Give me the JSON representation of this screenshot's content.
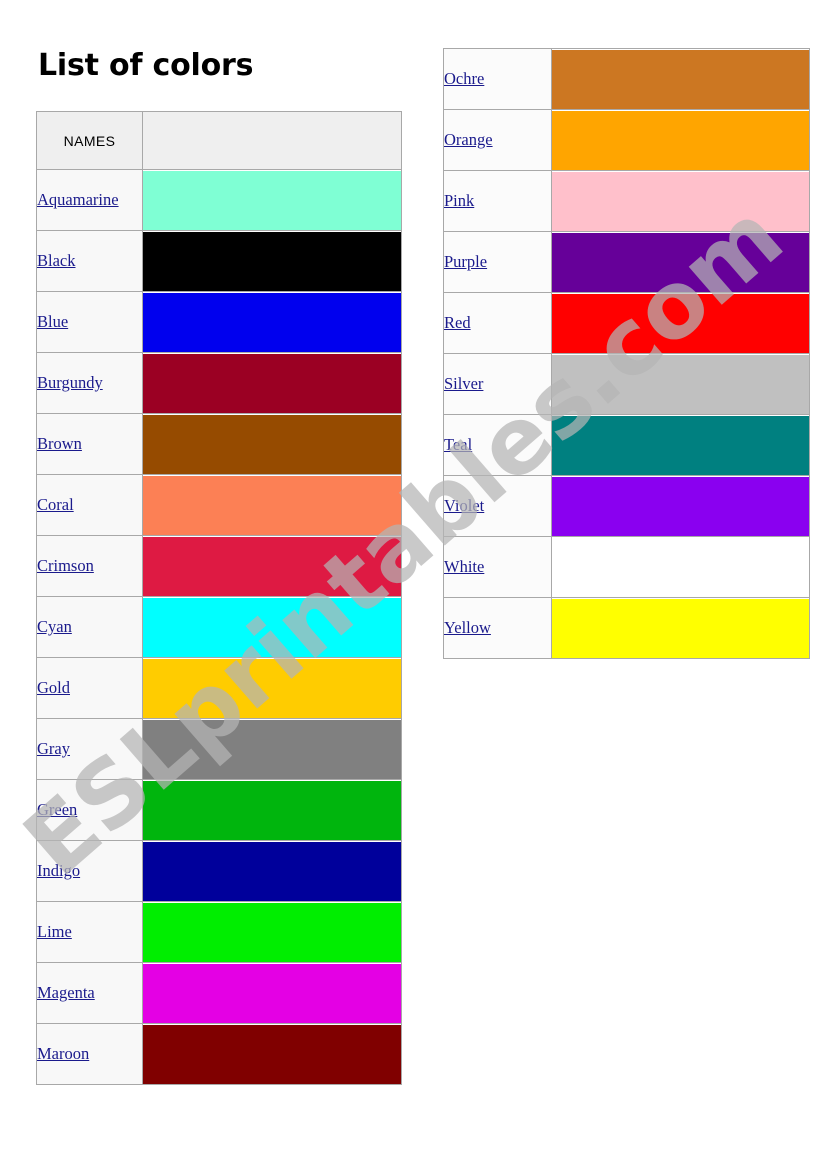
{
  "page": {
    "title": "List of colors",
    "watermark": "ESLprintables.com",
    "watermark_color": "#b4b4b4"
  },
  "left_table": {
    "header": {
      "names_label": "NAMES",
      "swatch_label": "",
      "background": "#efefef"
    },
    "rows": [
      {
        "name": "Aquamarine",
        "color": "#7FFFD4"
      },
      {
        "name": "Black",
        "color": "#000000"
      },
      {
        "name": "Blue",
        "color": "#0000EE"
      },
      {
        "name": "Burgundy",
        "color": "#9B0023"
      },
      {
        "name": "Brown",
        "color": "#964B00"
      },
      {
        "name": "Coral",
        "color": "#FC8055"
      },
      {
        "name": "Crimson",
        "color": "#DE1A43"
      },
      {
        "name": "Cyan",
        "color": "#00FFFF"
      },
      {
        "name": "Gold",
        "color": "#FFCC00"
      },
      {
        "name": "Gray",
        "color": "#808080"
      },
      {
        "name": "Green",
        "color": "#00B50D"
      },
      {
        "name": "Indigo",
        "color": "#00009B"
      },
      {
        "name": "Lime",
        "color": "#00EE00"
      },
      {
        "name": "Magenta",
        "color": "#E400E4"
      },
      {
        "name": "Maroon",
        "color": "#800000"
      }
    ]
  },
  "right_table": {
    "rows": [
      {
        "name": "Ochre",
        "color": "#CC7722"
      },
      {
        "name": "Orange",
        "color": "#FFA500"
      },
      {
        "name": "Pink",
        "color": "#FFC0CB"
      },
      {
        "name": "Purple",
        "color": "#660099"
      },
      {
        "name": "Red",
        "color": "#FF0000"
      },
      {
        "name": "Silver",
        "color": "#C0C0C0"
      },
      {
        "name": "Teal",
        "color": "#008080"
      },
      {
        "name": "Violet",
        "color": "#8A00F0"
      },
      {
        "name": "White",
        "color": "#FFFFFF"
      },
      {
        "name": "Yellow",
        "color": "#FFFF00"
      }
    ]
  }
}
